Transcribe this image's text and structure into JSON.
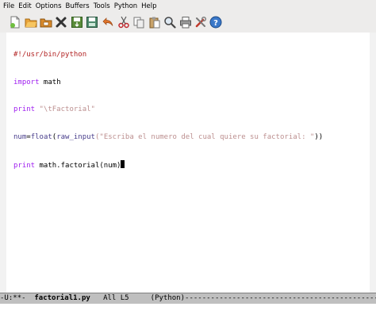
{
  "menu": [
    "File",
    "Edit",
    "Options",
    "Buffers",
    "Tools",
    "Python",
    "Help"
  ],
  "toolbar": {
    "icons": [
      "new-file-icon",
      "open-folder-icon",
      "open-directory-icon",
      "close-buffer-icon",
      "save-icon",
      "save-as-icon",
      "undo-icon",
      "cut-icon",
      "copy-icon",
      "paste-icon",
      "search-icon",
      "print-icon",
      "preferences-icon",
      "help-icon"
    ]
  },
  "code": {
    "line1": "#!/usr/bin/python",
    "line2_kw": "import",
    "line2_rest": " math",
    "line3_kw": "print",
    "line3_str": " \"\\tFactorial\"",
    "line4_var": "num",
    "line4_eq": "=",
    "line4_fn": "float",
    "line4_paren": "(",
    "line4_call": "raw_input",
    "line4_str": "(\"Escriba el numero del cual quiere su factorial: \"",
    "line4_end": "))",
    "line5_kw": "print",
    "line5_rest": " math.factorial(num)"
  },
  "modeline": {
    "status": "-U:**-  ",
    "buffer": "factorial1.py",
    "position": "   All L5     ",
    "mode": "(Python)",
    "fill": "------------------------------------------------------------"
  },
  "colors": {
    "keyword": "#a020f0",
    "string": "#bc8f8f",
    "function": "#0000ff",
    "builtin": "#483d8b",
    "modeline_bg": "#bfbfbf"
  }
}
